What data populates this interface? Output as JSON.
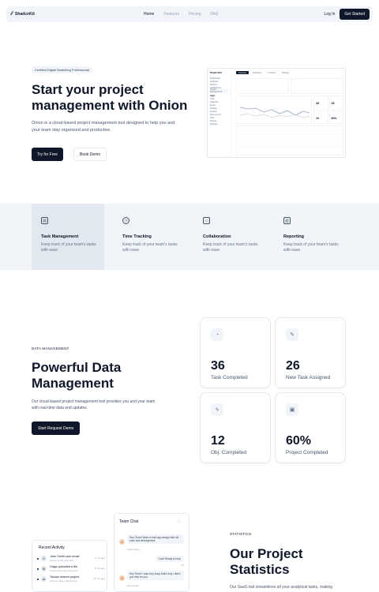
{
  "nav": {
    "brand": "ShadcnKit",
    "links": [
      "Home",
      "Features",
      "Pricing",
      "FAQ"
    ],
    "login": "Log In",
    "cta": "Get Started"
  },
  "hero": {
    "badge": "Certified Digital Marketing Professional",
    "title": "Start your project management with Onion",
    "description": "Onion is a cloud-based project management tool designed to help you and your team stay organized and productive.",
    "primary_button": "Try for Free",
    "secondary_button": "Book Demo"
  },
  "dashboard_preview": {
    "logo": "ShadcnKit",
    "side_items": [
      "Dashboard",
      "Analytics",
      "Reports",
      "Notifications",
      "Project Management"
    ],
    "side_section": "Apps",
    "side_items_2": [
      "Chat",
      "Calendar",
      "Email",
      "Kanban",
      "Invoice",
      "Ecommerce",
      "Files",
      "Pricing",
      "Settings"
    ],
    "tabs": [
      "Overview",
      "Customers",
      "Products",
      "Settings"
    ],
    "stats": [
      "28",
      "28",
      "10",
      "60%"
    ]
  },
  "features": [
    {
      "icon": "file-icon",
      "glyph": "▤",
      "title": "Task Management",
      "desc": "Keep track of your team's tasks with ease",
      "selected": true
    },
    {
      "icon": "clock-icon",
      "glyph": "◷",
      "title": "Time Tracking",
      "desc": "Keep track of your team's tasks with ease",
      "selected": false
    },
    {
      "icon": "message-icon",
      "glyph": "▭",
      "title": "Collaboration",
      "desc": "Keep track of your team's tasks with ease",
      "selected": false
    },
    {
      "icon": "report-icon",
      "glyph": "▥",
      "title": "Reporting",
      "desc": "Keep track of your team's tasks with ease",
      "selected": false
    }
  ],
  "data_management": {
    "eyebrow": "DATA MANAGEMENT",
    "title": "Powerful Data Management",
    "description": "Our cloud-based project management tool provides you and your team with real-time data and updates.",
    "button": "Start Request Demo"
  },
  "stat_cards": [
    {
      "icon": "pie-chart-icon",
      "glyph": "◔",
      "value": "36",
      "label": "Task Completed"
    },
    {
      "icon": "edit-icon",
      "glyph": "✎",
      "value": "26",
      "label": "New Task Assigned"
    },
    {
      "icon": "zap-icon",
      "glyph": "ϟ",
      "value": "12",
      "label": "Obj. Completed"
    },
    {
      "icon": "clipboard-icon",
      "glyph": "▣",
      "value": "60%",
      "label": "Project Completed"
    }
  ],
  "recent_activity": {
    "title": "Recent Activity",
    "items": [
      {
        "name": "John Smith sent email",
        "sub": "has an email your task",
        "time": "3 min ago"
      },
      {
        "name": "Gaga uploaded a file",
        "sub": "Fixed some bugs and error",
        "time": "8 min ago"
      },
      {
        "name": "Tavsan shared project",
        "sub": "It has to share attachment",
        "time": "15 min ago"
      }
    ]
  },
  "team_chat": {
    "title": "Team Chat",
    "messages": [
      {
        "text": "Hey There! Need a front app design with full price and development.",
        "meta": "Justin Moore"
      },
      {
        "text": "Cool! Ready to help.",
        "meta": "You"
      },
      {
        "text": "Hey There! I was very busy, that's why I didn't you help for you.",
        "meta": "Alex Hunter"
      }
    ]
  },
  "statistics": {
    "eyebrow": "STATISTICS",
    "title": "Our Project Statistics",
    "description": "Our SaaS tool streamlines all your analytical tasks, making"
  }
}
